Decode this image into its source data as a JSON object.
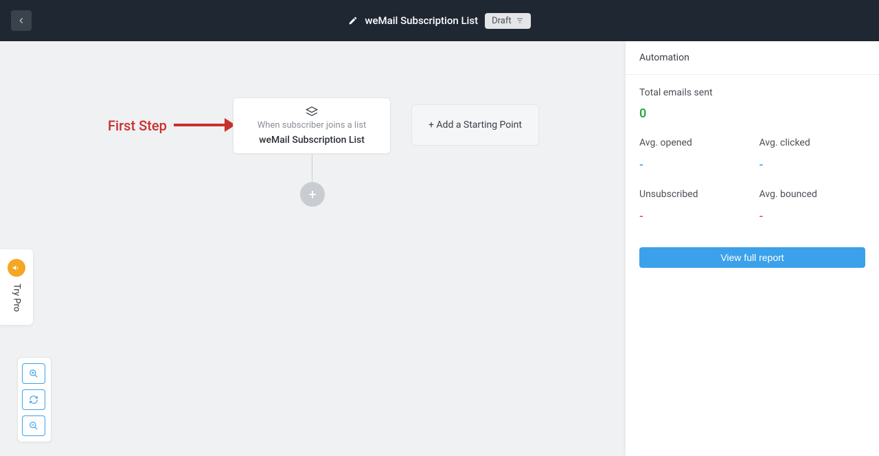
{
  "header": {
    "title": "weMail Subscription List",
    "status": "Draft"
  },
  "canvas": {
    "annotation": "First Step",
    "node": {
      "subtitle": "When subscriber joins a list",
      "title": "weMail Subscription List"
    },
    "add_starting_point": "+ Add a Starting Point",
    "plus": "+"
  },
  "sidebar": {
    "heading": "Automation",
    "total_label": "Total emails sent",
    "total_value": "0",
    "stats": {
      "avg_opened_label": "Avg. opened",
      "avg_opened_value": "-",
      "avg_clicked_label": "Avg. clicked",
      "avg_clicked_value": "-",
      "unsub_label": "Unsubscribed",
      "unsub_value": "-",
      "avg_bounced_label": "Avg. bounced",
      "avg_bounced_value": "-"
    },
    "view_report": "View full report"
  },
  "try_pro": "Try Pro"
}
